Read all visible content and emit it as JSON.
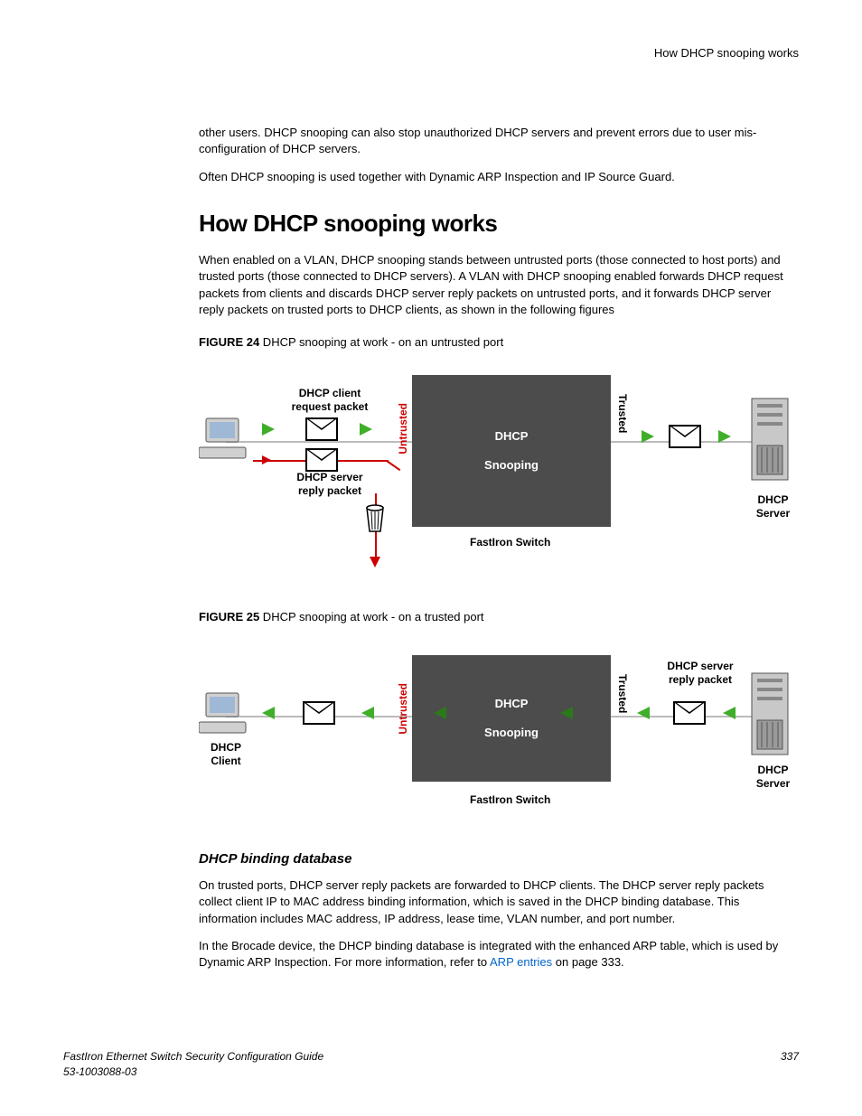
{
  "running_head": "How DHCP snooping works",
  "intro": {
    "p1": "other users. DHCP snooping can also stop unauthorized DHCP servers and prevent errors due to user mis-configuration of DHCP servers.",
    "p2": "Often DHCP snooping is used together with Dynamic ARP Inspection and IP Source Guard."
  },
  "section_title": "How DHCP snooping works",
  "section_p1": "When enabled on a VLAN, DHCP snooping stands between untrusted ports (those connected to host ports) and trusted ports (those connected to DHCP servers). A VLAN with DHCP snooping enabled forwards DHCP request packets from clients and discards DHCP server reply packets on untrusted ports, and it forwards DHCP server reply packets on trusted ports to DHCP clients, as shown in the following figures",
  "fig24": {
    "prefix": "FIGURE 24",
    "caption": " DHCP snooping at work - on an untrusted port",
    "labels": {
      "client_request": "DHCP client\nrequest packet",
      "server_reply": "DHCP server\nreply packet",
      "untrusted": "Untrusted",
      "trusted": "Trusted",
      "switch": "FastIron Switch",
      "dhcp_snooping_1": "DHCP",
      "dhcp_snooping_2": "Snooping",
      "dhcp_server": "DHCP\nServer"
    }
  },
  "fig25": {
    "prefix": "FIGURE 25",
    "caption": " DHCP snooping at work - on a trusted port",
    "labels": {
      "dhcp_client": "DHCP\nClient",
      "server_reply": "DHCP server\nreply packet",
      "untrusted": "Untrusted",
      "trusted": "Trusted",
      "switch": "FastIron Switch",
      "dhcp_snooping_1": "DHCP",
      "dhcp_snooping_2": "Snooping",
      "dhcp_server": "DHCP\nServer"
    }
  },
  "subhead": "DHCP binding database",
  "db_p1": "On trusted ports, DHCP server reply packets are forwarded to DHCP clients. The DHCP server reply packets collect client IP to MAC address binding information, which is saved in the DHCP binding database. This information includes MAC address, IP address, lease time, VLAN number, and port number.",
  "db_p2a": "In the Brocade device, the DHCP binding database is integrated with the enhanced ARP table, which is used by Dynamic ARP Inspection. For more information, refer to ",
  "db_link": "ARP entries",
  "db_p2b": " on page 333.",
  "footer": {
    "guide": "FastIron Ethernet Switch Security Configuration Guide",
    "docnum": "53-1003088-03",
    "page": "337"
  }
}
